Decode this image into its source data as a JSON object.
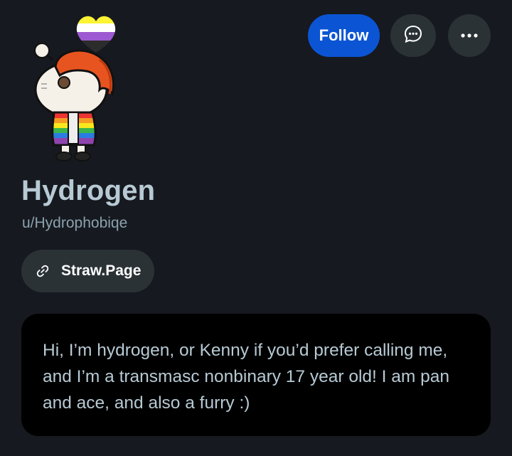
{
  "profile": {
    "display_name": "Hydrogen",
    "username": "u/Hydrophobiqe",
    "bio": "Hi, I’m hydrogen, or Kenny if you’d prefer calling me, and I’m a transmasc nonbinary 17 year old! I am pan and ace, and also a furry :)"
  },
  "actions": {
    "follow_label": "Follow",
    "chat_icon": "chat-bubble-icon",
    "more_icon": "more-horizontal-icon"
  },
  "social_link": {
    "label": "Straw.Page",
    "icon": "link-icon"
  },
  "avatar": {
    "icon": "snoo-avatar",
    "accessory": "nonbinary-flag-heart"
  },
  "colors": {
    "background": "#16191f",
    "accent": "#0b55d4",
    "chip_background": "#2a3236",
    "primary_text": "#b7cad4",
    "secondary_text": "#8ba2ad",
    "bio_card": "#000000",
    "nb_yellow": "#fcf434",
    "nb_white": "#ffffff",
    "nb_purple": "#9c59d1",
    "nb_black": "#2c2c2c"
  }
}
